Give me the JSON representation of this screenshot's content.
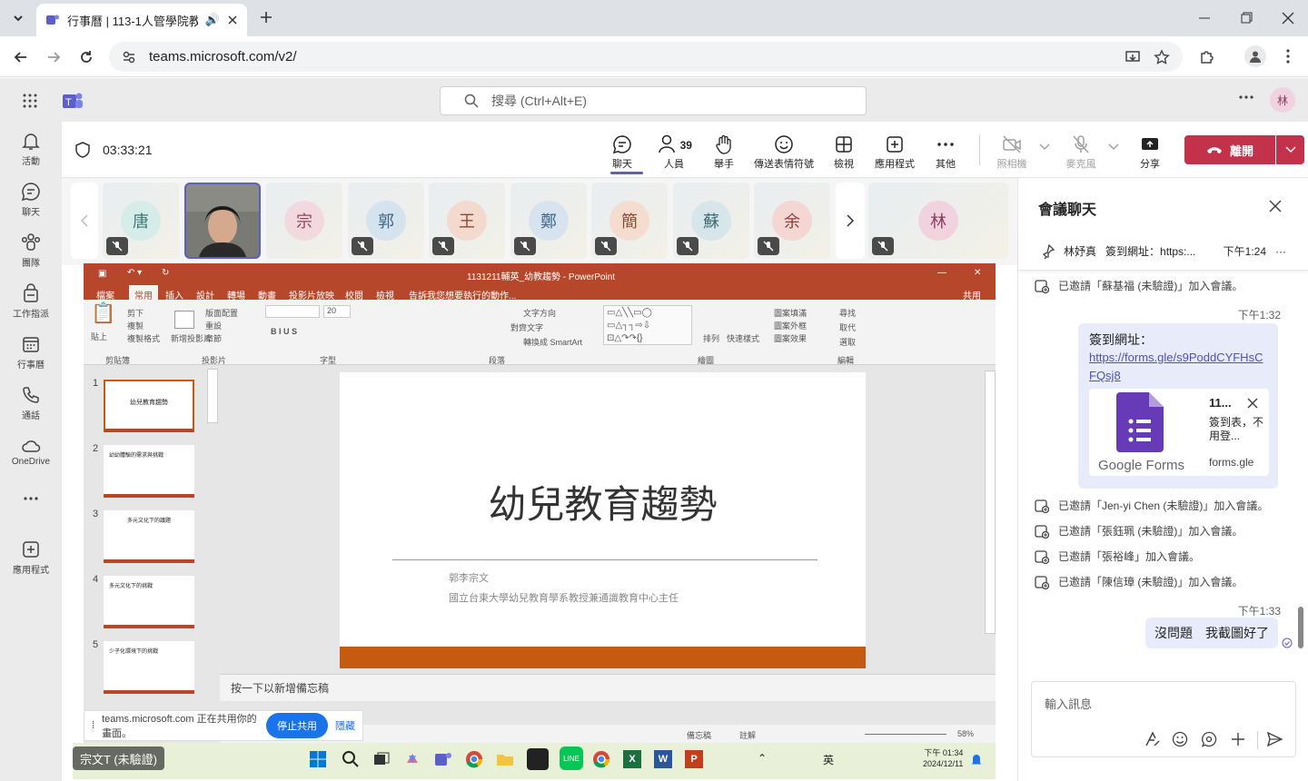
{
  "browser": {
    "tab_title": "行事曆 | 113-1人管學院教師",
    "url": "teams.microsoft.com/v2/"
  },
  "teams": {
    "search_placeholder": "搜尋 (Ctrl+Alt+E)",
    "user_initial": "林",
    "rail": [
      {
        "label": "活動",
        "icon": "bell-icon"
      },
      {
        "label": "聊天",
        "icon": "chat-icon"
      },
      {
        "label": "團隊",
        "icon": "teams-icon"
      },
      {
        "label": "工作指派",
        "icon": "assignments-icon"
      },
      {
        "label": "行事曆",
        "icon": "calendar-icon"
      },
      {
        "label": "通話",
        "icon": "phone-icon"
      },
      {
        "label": "OneDrive",
        "icon": "cloud-icon"
      },
      {
        "label": "應用程式",
        "icon": "apps-icon"
      }
    ]
  },
  "meeting": {
    "timer": "03:33:21",
    "participants_count": "39",
    "toolbar": {
      "chat": "聊天",
      "people": "人員",
      "raise": "舉手",
      "react": "傳送表情符號",
      "view": "檢視",
      "apps": "應用程式",
      "more": "其他",
      "camera": "照相機",
      "mic": "麥克風",
      "share": "分享",
      "leave": "離開"
    },
    "participants": [
      {
        "initial": "唐",
        "color": "#d6ece9"
      },
      {
        "initial": "",
        "color": ""
      },
      {
        "initial": "宗",
        "color": "#f2d9e0"
      },
      {
        "initial": "郭",
        "color": "#d4e3ee"
      },
      {
        "initial": "王",
        "color": "#f4d9cf"
      },
      {
        "initial": "鄭",
        "color": "#d7e4ef"
      },
      {
        "initial": "簡",
        "color": "#f4dccf"
      },
      {
        "initial": "蘇",
        "color": "#d6e6ea"
      },
      {
        "initial": "余",
        "color": "#f4d6d3"
      },
      {
        "initial": "林",
        "color": "#f1d3e0"
      }
    ]
  },
  "ppt": {
    "title": "1131211輔英_幼教趨勢 - PowerPoint",
    "menu": [
      "檔案",
      "常用",
      "插入",
      "設計",
      "轉場",
      "動畫",
      "投影片放映",
      "校閱",
      "檢視"
    ],
    "tellme": "告訴我您想要執行的動作...",
    "share": "共用",
    "groups": [
      "剪貼簿",
      "投影片",
      "字型",
      "段落",
      "繪圖",
      "編輯"
    ],
    "ribbon": {
      "cut": "剪下",
      "copy": "複製",
      "format": "複製格式",
      "paste": "貼上",
      "new_slide": "新增投影片",
      "layout": "版面配置",
      "reset": "重設",
      "section": "章節",
      "font_size": "20",
      "text_dir": "文字方向",
      "align_text": "對齊文字",
      "smartart": "轉換成 SmartArt",
      "arrange": "排列",
      "quick": "快速樣式",
      "fill": "圖案填滿",
      "outline": "圖案外框",
      "effect": "圖案效果",
      "find": "尋找",
      "replace": "取代",
      "select": "選取"
    },
    "slide_title": "幼兒教育趨勢",
    "slide_author": "郭李宗文",
    "slide_affil": "國立台東大學幼兒教育學系教授兼通識教育中心主任",
    "thumbs": [
      {
        "num": "1",
        "title": "幼兒教育趨勢"
      },
      {
        "num": "2",
        "title": "幼幼體驗的需求與挑戰"
      },
      {
        "num": "3",
        "title": "多元文化下的議題"
      },
      {
        "num": "4",
        "title": "多元文化下的挑戰"
      },
      {
        "num": "5",
        "title": "少子化環境下的挑戰"
      }
    ],
    "notes": "按一下以新增備忘稿",
    "status_notes": "備忘稿",
    "status_comments": "註解",
    "zoom": "58%"
  },
  "share_banner": {
    "text": "teams.microsoft.com 正在共用你的畫面。",
    "stop": "停止共用",
    "hide": "隱藏"
  },
  "presenter_label": "宗文T (未驗證)",
  "taskbar": {
    "ime": "英",
    "time": "下午 01:34",
    "date": "2024/12/11"
  },
  "chat": {
    "title": "會議聊天",
    "pinned_name": "林妤真",
    "pinned_text": "簽到網址：https:...",
    "pinned_time": "下午1:24",
    "sys": [
      "已邀請「蘇基福 (未驗證)」加入會議。",
      "已邀請「Jen-yi Chen (未驗證)」加入會議。",
      "已邀請「張鈺珮 (未驗證)」加入會議。",
      "已邀請「張裕峰」加入會議。",
      "已邀請「陳信璋 (未驗證)」加入會議。"
    ],
    "time1": "下午1:32",
    "msg1_label": "簽到網址：",
    "msg1_link": "https://forms.gle/s9PoddCYFHsCFQsj8",
    "card_title": "11...",
    "card_desc": "簽到表，不用登...",
    "card_domain": "forms.gle",
    "card_brand": "Google Forms",
    "time2": "下午1:33",
    "msg2": "沒問題　我截圖好了",
    "compose_placeholder": "輸入訊息"
  }
}
